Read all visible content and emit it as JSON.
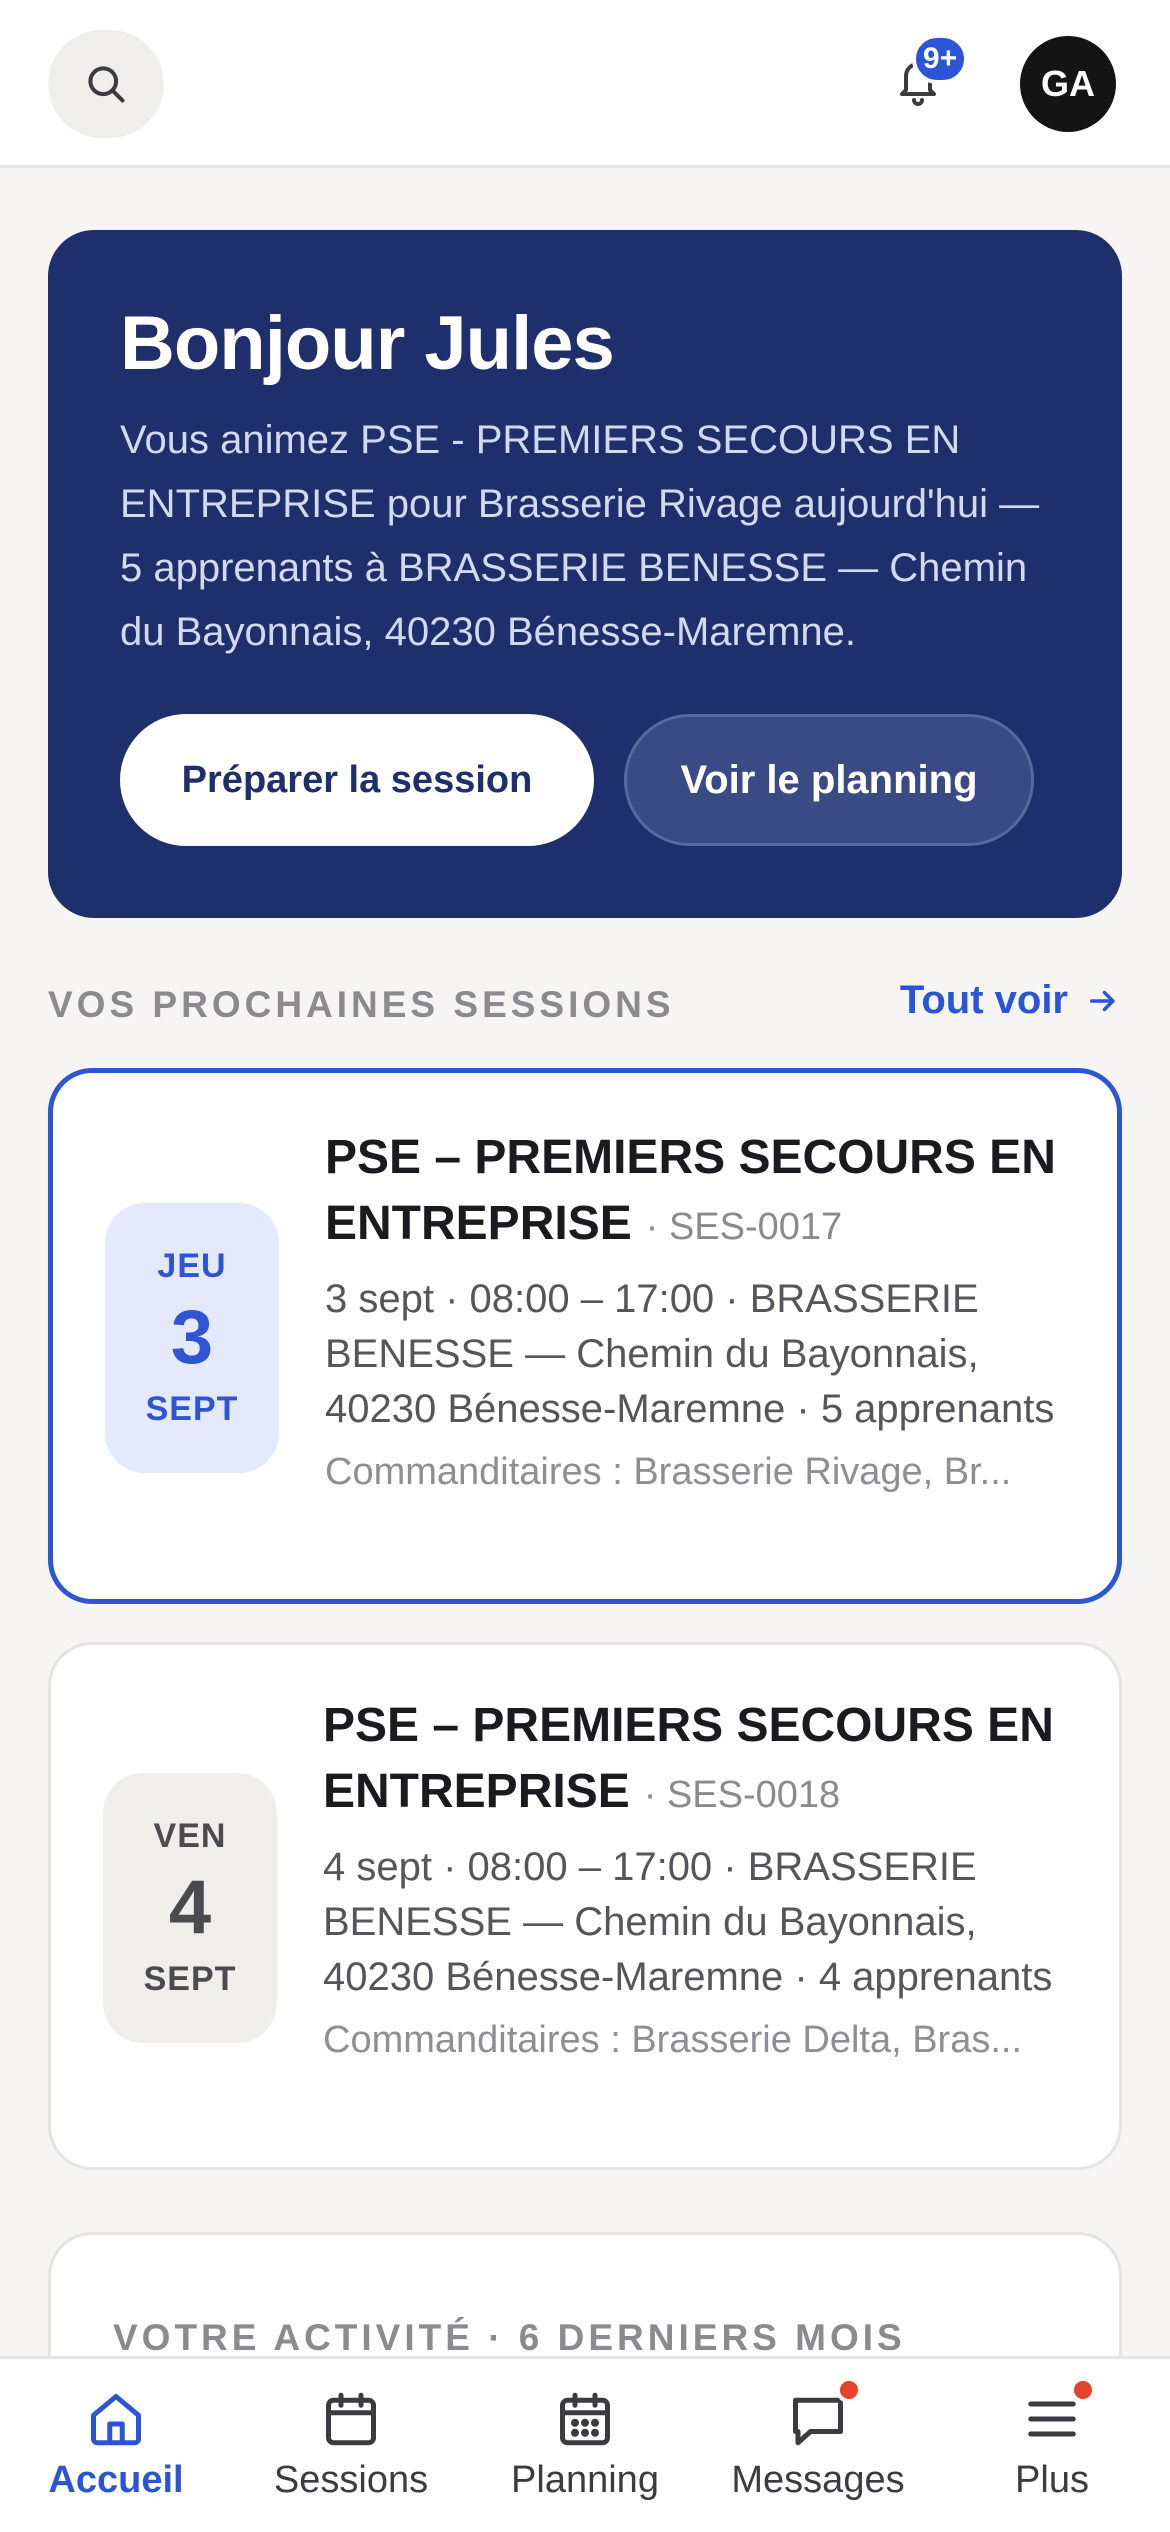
{
  "header": {
    "notification_count": "9+",
    "avatar_initials": "GA"
  },
  "hero": {
    "greeting": "Bonjour Jules",
    "text": "Vous animez PSE - PREMIERS SECOURS EN ENTREPRISE pour Brasserie Rivage aujourd'hui — 5 apprenants à BRASSERIE BENESSE — Chemin du Bayonnais, 40230 Bénesse-Maremne.",
    "primary_button": "Préparer la session",
    "secondary_button": "Voir le planning"
  },
  "sessions_section": {
    "title": "VOS PROCHAINES SESSIONS",
    "see_all": "Tout voir"
  },
  "sessions": [
    {
      "dow": "JEU",
      "day": "3",
      "month": "SEPT",
      "title": "PSE – PREMIERS SECOURS EN ENTREPRISE",
      "code": "· SES-0017",
      "meta": "3 sept · 08:00 – 17:00 · BRASSERIE BENESSE — Chemin du Bayonnais, 40230 Bénesse-Maremne · 5 apprenants",
      "sponsors": "Commanditaires : Brasserie Rivage, Br..."
    },
    {
      "dow": "VEN",
      "day": "4",
      "month": "SEPT",
      "title": "PSE – PREMIERS SECOURS EN ENTREPRISE",
      "code": "· SES-0018",
      "meta": "4 sept · 08:00 – 17:00 · BRASSERIE BENESSE — Chemin du Bayonnais, 40230 Bénesse-Maremne · 4 apprenants",
      "sponsors": "Commanditaires : Brasserie Delta, Bras..."
    }
  ],
  "activity": {
    "title": "VOTRE ACTIVITÉ · 6 DERNIERS MOIS"
  },
  "nav": {
    "items": [
      {
        "label": "Accueil",
        "icon": "home-icon",
        "active": true
      },
      {
        "label": "Sessions",
        "icon": "calendar-icon"
      },
      {
        "label": "Planning",
        "icon": "calendar-grid-icon"
      },
      {
        "label": "Messages",
        "icon": "chat-icon",
        "dot": true
      },
      {
        "label": "Plus",
        "icon": "menu-icon",
        "dot": true
      }
    ]
  },
  "colors": {
    "accent": "#2b55d6",
    "hero_bg": "#1f2f6b",
    "notification_dot": "#e5442b"
  }
}
